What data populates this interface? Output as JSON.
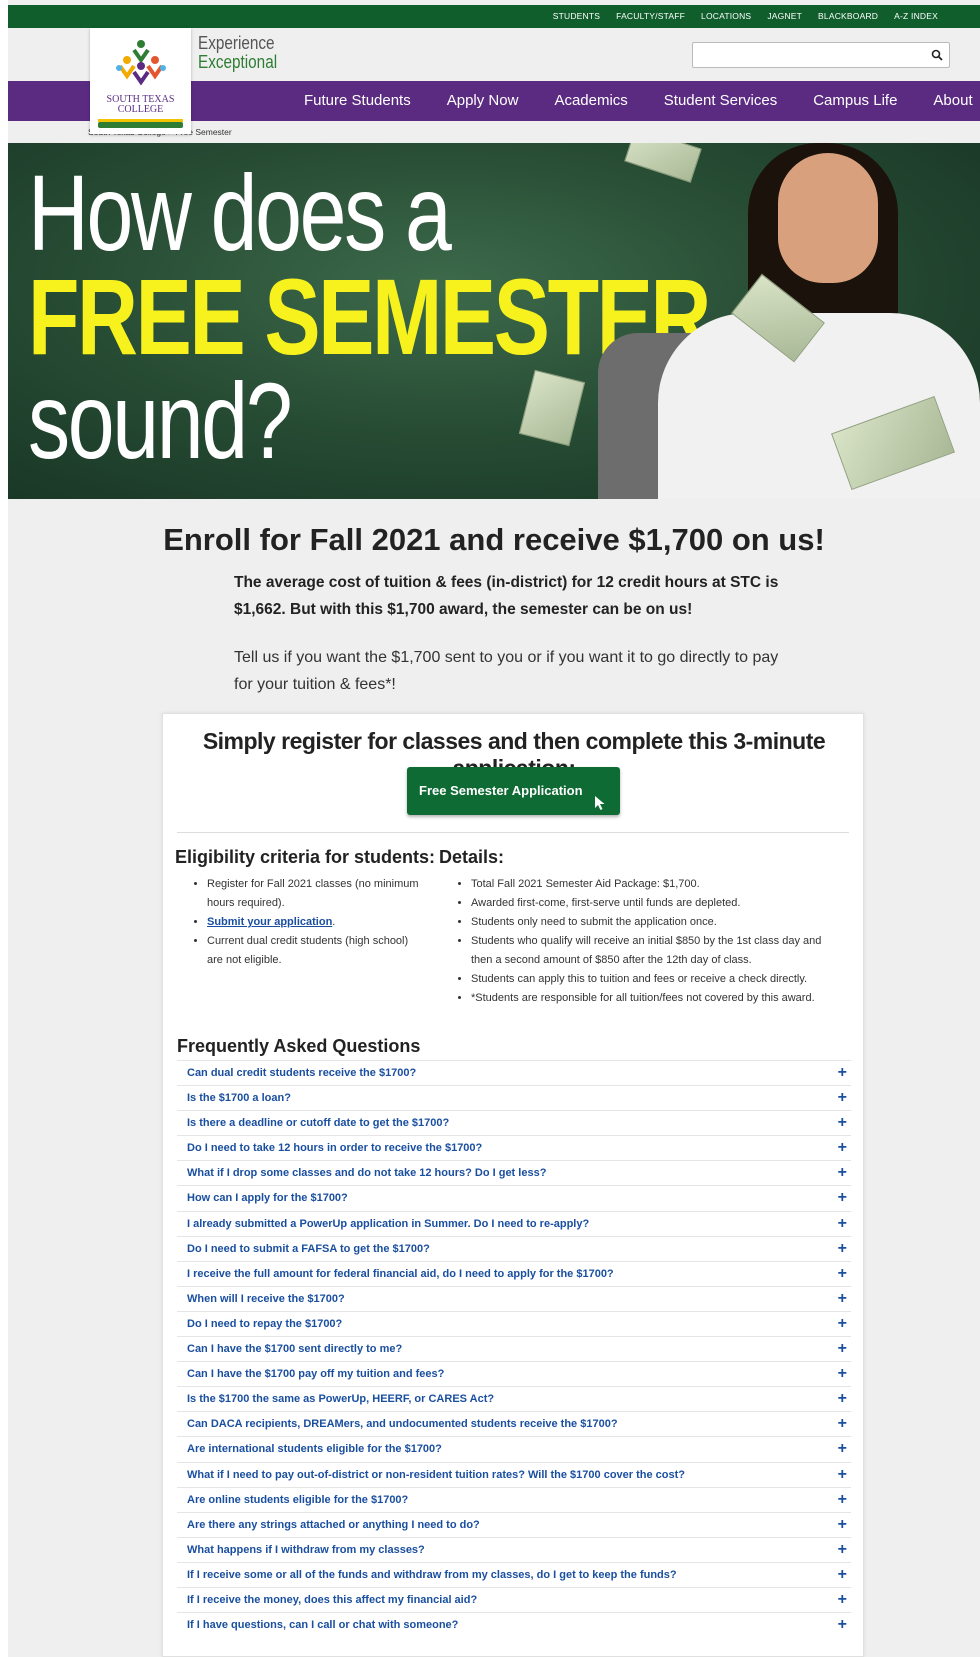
{
  "utility_nav": [
    "STUDENTS",
    "FACULTY/STAFF",
    "LOCATIONS",
    "JAGNET",
    "BLACKBOARD",
    "A-Z INDEX"
  ],
  "logo": {
    "line1": "SOUTH TEXAS",
    "line2": "COLLEGE"
  },
  "tagline": {
    "line1": "Experience",
    "line2": "Exceptional"
  },
  "search": {
    "placeholder": "",
    "value": ""
  },
  "main_nav": [
    "Future Students",
    "Apply Now",
    "Academics",
    "Student Services",
    "Campus Life",
    "About"
  ],
  "breadcrumb": "South Texas College > Free Semester",
  "hero": {
    "line1": "How does a",
    "line2": "FREE SEMESTER",
    "line3": "sound?"
  },
  "intro": {
    "title": "Enroll for Fall 2021 and receive $1,700 on us!",
    "bold": "The average cost of tuition & fees (in-district) for 12 credit hours at STC is $1,662. But with this $1,700 award, the semester can be on us!",
    "plain": "Tell us if you want the $1,700 sent to you or if you want it to go directly to pay for your tuition & fees*!"
  },
  "card": {
    "title": "Simply register for classes and then complete this 3-minute application:",
    "button": "Free Semester Application",
    "eligibility_title": "Eligibility criteria for students:",
    "eligibility": {
      "item1": "Register for Fall 2021 classes (no minimum hours required).",
      "item2_link": "Submit your application",
      "item2_after": ".",
      "item3": "Current dual credit students (high school) are not eligible."
    },
    "details_title": "Details:",
    "details": [
      "Total Fall 2021 Semester Aid Package: $1,700.",
      "Awarded first-come, first-serve until funds are depleted.",
      "Students only need to submit the application once.",
      "Students who qualify will receive an initial $850 by the 1st class day and then a second amount of $850 after the 12th day of class.",
      "Students can apply this to tuition and fees or receive a check directly.",
      "*Students are responsible for all tuition/fees not covered by this award."
    ]
  },
  "faq": {
    "title": "Frequently Asked Questions",
    "expand_symbol": "+",
    "questions": [
      "Can dual credit students receive the $1700?",
      "Is the $1700 a loan?",
      "Is there a deadline or cutoff date to get the $1700?",
      "Do I need to take 12 hours in order to receive the $1700?",
      "What if I drop some classes and do not take 12 hours? Do I get less?",
      "How can I apply for the $1700?",
      "I already submitted a PowerUp application in Summer. Do I need to re-apply?",
      "Do I need to submit a FAFSA to get the $1700?",
      "I receive the full amount for federal financial aid, do I need to apply for the $1700?",
      "When will I receive the $1700?",
      "Do I need to repay the $1700?",
      "Can I have the $1700 sent directly to me?",
      "Can I have the $1700 pay off my tuition and fees?",
      "Is the $1700 the same as PowerUp, HEERF, or CARES Act?",
      "Can DACA recipients, DREAMers, and undocumented students receive the $1700?",
      "Are international students eligible for the $1700?",
      "What if I need to pay out-of-district or non-resident tuition rates? Will the $1700 cover the cost?",
      "Are online students eligible for the $1700?",
      "Are there any strings attached or anything I need to do?",
      "What happens if I withdraw from my classes?",
      "If I receive some or all of the funds and withdraw from my classes, do I get to keep the funds?",
      "If I receive the money, does this affect my financial aid?",
      "If I have questions, can I call or chat with someone?"
    ]
  },
  "colors": {
    "green": "#0f5e2c",
    "purple": "#5b2b82",
    "yellow": "#f7f21d",
    "link_blue": "#1a4fa0"
  }
}
